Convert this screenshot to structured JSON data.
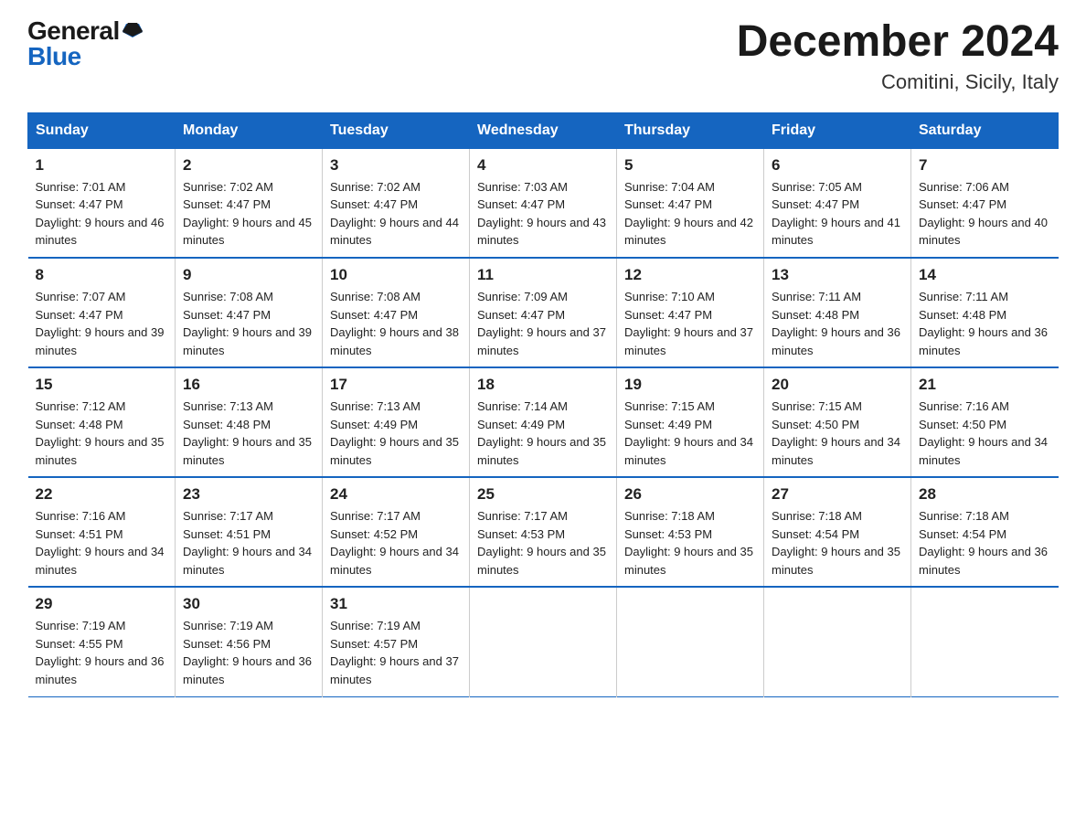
{
  "header": {
    "logo_general": "General",
    "logo_blue": "Blue",
    "month_title": "December 2024",
    "location": "Comitini, Sicily, Italy"
  },
  "days_of_week": [
    "Sunday",
    "Monday",
    "Tuesday",
    "Wednesday",
    "Thursday",
    "Friday",
    "Saturday"
  ],
  "weeks": [
    [
      {
        "day": "1",
        "sunrise": "7:01 AM",
        "sunset": "4:47 PM",
        "daylight": "9 hours and 46 minutes."
      },
      {
        "day": "2",
        "sunrise": "7:02 AM",
        "sunset": "4:47 PM",
        "daylight": "9 hours and 45 minutes."
      },
      {
        "day": "3",
        "sunrise": "7:02 AM",
        "sunset": "4:47 PM",
        "daylight": "9 hours and 44 minutes."
      },
      {
        "day": "4",
        "sunrise": "7:03 AM",
        "sunset": "4:47 PM",
        "daylight": "9 hours and 43 minutes."
      },
      {
        "day": "5",
        "sunrise": "7:04 AM",
        "sunset": "4:47 PM",
        "daylight": "9 hours and 42 minutes."
      },
      {
        "day": "6",
        "sunrise": "7:05 AM",
        "sunset": "4:47 PM",
        "daylight": "9 hours and 41 minutes."
      },
      {
        "day": "7",
        "sunrise": "7:06 AM",
        "sunset": "4:47 PM",
        "daylight": "9 hours and 40 minutes."
      }
    ],
    [
      {
        "day": "8",
        "sunrise": "7:07 AM",
        "sunset": "4:47 PM",
        "daylight": "9 hours and 39 minutes."
      },
      {
        "day": "9",
        "sunrise": "7:08 AM",
        "sunset": "4:47 PM",
        "daylight": "9 hours and 39 minutes."
      },
      {
        "day": "10",
        "sunrise": "7:08 AM",
        "sunset": "4:47 PM",
        "daylight": "9 hours and 38 minutes."
      },
      {
        "day": "11",
        "sunrise": "7:09 AM",
        "sunset": "4:47 PM",
        "daylight": "9 hours and 37 minutes."
      },
      {
        "day": "12",
        "sunrise": "7:10 AM",
        "sunset": "4:47 PM",
        "daylight": "9 hours and 37 minutes."
      },
      {
        "day": "13",
        "sunrise": "7:11 AM",
        "sunset": "4:48 PM",
        "daylight": "9 hours and 36 minutes."
      },
      {
        "day": "14",
        "sunrise": "7:11 AM",
        "sunset": "4:48 PM",
        "daylight": "9 hours and 36 minutes."
      }
    ],
    [
      {
        "day": "15",
        "sunrise": "7:12 AM",
        "sunset": "4:48 PM",
        "daylight": "9 hours and 35 minutes."
      },
      {
        "day": "16",
        "sunrise": "7:13 AM",
        "sunset": "4:48 PM",
        "daylight": "9 hours and 35 minutes."
      },
      {
        "day": "17",
        "sunrise": "7:13 AM",
        "sunset": "4:49 PM",
        "daylight": "9 hours and 35 minutes."
      },
      {
        "day": "18",
        "sunrise": "7:14 AM",
        "sunset": "4:49 PM",
        "daylight": "9 hours and 35 minutes."
      },
      {
        "day": "19",
        "sunrise": "7:15 AM",
        "sunset": "4:49 PM",
        "daylight": "9 hours and 34 minutes."
      },
      {
        "day": "20",
        "sunrise": "7:15 AM",
        "sunset": "4:50 PM",
        "daylight": "9 hours and 34 minutes."
      },
      {
        "day": "21",
        "sunrise": "7:16 AM",
        "sunset": "4:50 PM",
        "daylight": "9 hours and 34 minutes."
      }
    ],
    [
      {
        "day": "22",
        "sunrise": "7:16 AM",
        "sunset": "4:51 PM",
        "daylight": "9 hours and 34 minutes."
      },
      {
        "day": "23",
        "sunrise": "7:17 AM",
        "sunset": "4:51 PM",
        "daylight": "9 hours and 34 minutes."
      },
      {
        "day": "24",
        "sunrise": "7:17 AM",
        "sunset": "4:52 PM",
        "daylight": "9 hours and 34 minutes."
      },
      {
        "day": "25",
        "sunrise": "7:17 AM",
        "sunset": "4:53 PM",
        "daylight": "9 hours and 35 minutes."
      },
      {
        "day": "26",
        "sunrise": "7:18 AM",
        "sunset": "4:53 PM",
        "daylight": "9 hours and 35 minutes."
      },
      {
        "day": "27",
        "sunrise": "7:18 AM",
        "sunset": "4:54 PM",
        "daylight": "9 hours and 35 minutes."
      },
      {
        "day": "28",
        "sunrise": "7:18 AM",
        "sunset": "4:54 PM",
        "daylight": "9 hours and 36 minutes."
      }
    ],
    [
      {
        "day": "29",
        "sunrise": "7:19 AM",
        "sunset": "4:55 PM",
        "daylight": "9 hours and 36 minutes."
      },
      {
        "day": "30",
        "sunrise": "7:19 AM",
        "sunset": "4:56 PM",
        "daylight": "9 hours and 36 minutes."
      },
      {
        "day": "31",
        "sunrise": "7:19 AM",
        "sunset": "4:57 PM",
        "daylight": "9 hours and 37 minutes."
      },
      null,
      null,
      null,
      null
    ]
  ]
}
